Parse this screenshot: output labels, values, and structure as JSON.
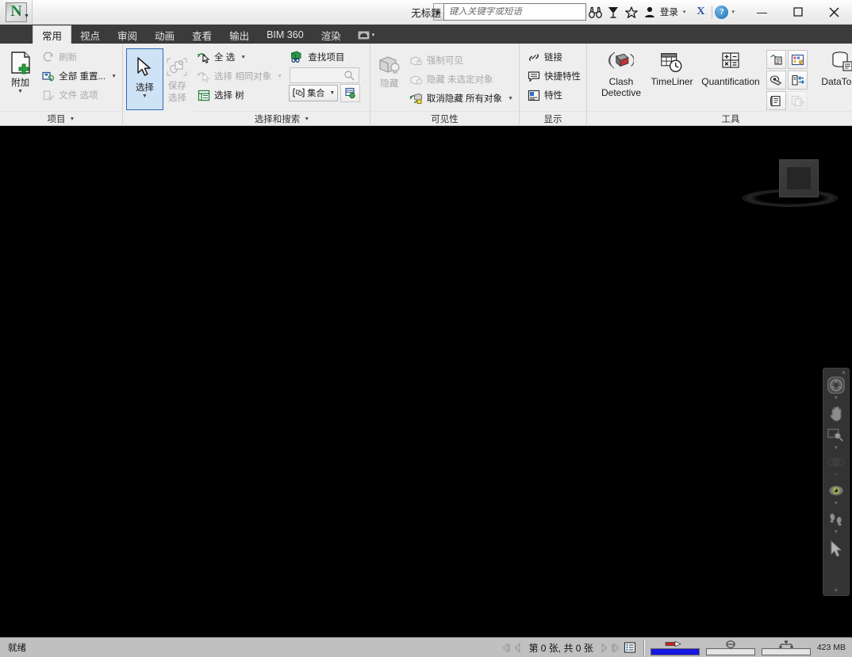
{
  "window": {
    "title": "无标题",
    "app_logo_letter": "N",
    "minimize_label": "—",
    "maximize_label": "▢",
    "close_label": "✕"
  },
  "quick_access": {
    "search_placeholder": "键入关键字或短语",
    "expand_arrow": "▶",
    "signin_label": "登录",
    "dropdown_caret": "▾",
    "exchange_label": "X",
    "help_label": "?",
    "icons": [
      "binoculars-icon",
      "satellite-icon",
      "star-icon",
      "person-icon"
    ]
  },
  "tabs": [
    {
      "label": "常用",
      "active": true
    },
    {
      "label": "视点",
      "active": false
    },
    {
      "label": "审阅",
      "active": false
    },
    {
      "label": "动画",
      "active": false
    },
    {
      "label": "查看",
      "active": false
    },
    {
      "label": "输出",
      "active": false
    },
    {
      "label": "BIM 360",
      "active": false
    },
    {
      "label": "渲染",
      "active": false
    }
  ],
  "ribbon": {
    "panels": [
      {
        "title": "项目",
        "title_caret": "▼",
        "big_button": {
          "label": "附加",
          "caret": "▼",
          "icon": "append-file-icon"
        },
        "rows": [
          {
            "icon": "refresh-icon",
            "text": "刷新",
            "dim": true
          },
          {
            "icon": "reset-all-icon",
            "text": "全部 重置...",
            "caret": "▼",
            "dim": false
          },
          {
            "icon": "file-options-icon",
            "text": "文件 选项",
            "dim": true
          }
        ]
      },
      {
        "title": "",
        "big_button": {
          "label": "选择",
          "caret": "▼",
          "icon": "select-cursor-icon",
          "selected": true
        },
        "save_selection": {
          "line1": "保存",
          "line2": "选择",
          "icon": "save-selection-icon",
          "dim": true
        }
      },
      {
        "title": "选择和搜索",
        "title_caret": "▼",
        "rows": [
          {
            "icon": "select-all-icon",
            "text": "全 选",
            "caret": "▼",
            "dim": false
          },
          {
            "icon": "select-same-icon",
            "text": "选择 相同对象",
            "caret": "▼",
            "dim": true
          },
          {
            "icon": "selection-tree-icon",
            "text": "选择 树",
            "dim": false
          }
        ],
        "rows2": [
          {
            "icon": "find-items-icon",
            "text": "查找项目"
          }
        ],
        "search_field_icon": "quick-find-icon",
        "sets_combo": {
          "label": "集合",
          "caret": "▼",
          "icon": "sets-icon"
        },
        "sets_extra_icon": "sets-manage-icon"
      },
      {
        "title": "可见性",
        "big_button": {
          "label": "隐藏",
          "icon": "hide-box-icon",
          "dim": true
        },
        "rows": [
          {
            "icon": "force-visible-icon",
            "text": "强制可见",
            "dim": true
          },
          {
            "icon": "hide-unselected-icon",
            "text": "隐藏 未选定对象",
            "dim": true
          },
          {
            "icon": "unhide-all-icon",
            "text": "取消隐藏 所有对象",
            "caret": "▼",
            "dim": false
          }
        ]
      },
      {
        "title": "显示",
        "rows": [
          {
            "icon": "link-icon",
            "text": "链接"
          },
          {
            "icon": "quick-properties-icon",
            "text": "快捷特性"
          },
          {
            "icon": "properties-icon",
            "text": "特性"
          }
        ]
      },
      {
        "title": "工具",
        "buttons": [
          {
            "label": "Clash Detective",
            "icon": "clash-detective-icon"
          },
          {
            "label": "TimeLiner",
            "icon": "timeliner-icon"
          },
          {
            "label": "Quantification",
            "icon": "quantification-icon"
          },
          {
            "label": "DataTools",
            "icon": "datatools-icon"
          }
        ],
        "grid_icons": [
          "appearance-profiler-icon",
          "batch-utility-icon",
          "compare-icon",
          "switchback-icon",
          "scripter-icon",
          "export-icon"
        ]
      }
    ]
  },
  "viewport": {
    "viewcube_name": "view-cube",
    "navbar": {
      "close_label": "×",
      "items": [
        {
          "icon": "steering-wheel-icon",
          "caret": "▼"
        },
        {
          "icon": "pan-hand-icon",
          "caret": ""
        },
        {
          "icon": "zoom-window-icon",
          "caret": "▼"
        },
        {
          "icon": "orbit-disabled-icon",
          "caret": "▼"
        },
        {
          "icon": "look-around-eye-icon",
          "caret": "▼"
        },
        {
          "icon": "walk-footprints-icon",
          "caret": "▼"
        },
        {
          "icon": "select-arrow-icon",
          "caret": ""
        }
      ],
      "grip_label": "≡"
    }
  },
  "status_bar": {
    "ready_text": "就绪",
    "nav_first": "◁|",
    "nav_prev": "◁",
    "page_text": "第 0 张, 共 0 张",
    "nav_next": "▷",
    "nav_last": "|▷",
    "sheet_browser_icon": "sheet-browser-icon",
    "meters": [
      {
        "icon": "pencil-draw-icon",
        "fill_percent": 100,
        "fill_color": "#1717e2"
      },
      {
        "icon": "disk-io-icon",
        "fill_percent": 0,
        "fill_color": "#1717e2"
      },
      {
        "icon": "network-icon",
        "fill_percent": 0,
        "fill_color": "#1717e2"
      }
    ],
    "memory_text": "423 MB"
  },
  "colors": {
    "ribbon_bg": "#eeeeee",
    "tabstrip_bg": "#3b3b3b",
    "viewport_bg": "#000000",
    "status_bg": "#c0c0c0",
    "selection_blue": "#cfe3f7",
    "selection_border": "#2f6ab5",
    "accent_green": "#1d8a3f"
  }
}
